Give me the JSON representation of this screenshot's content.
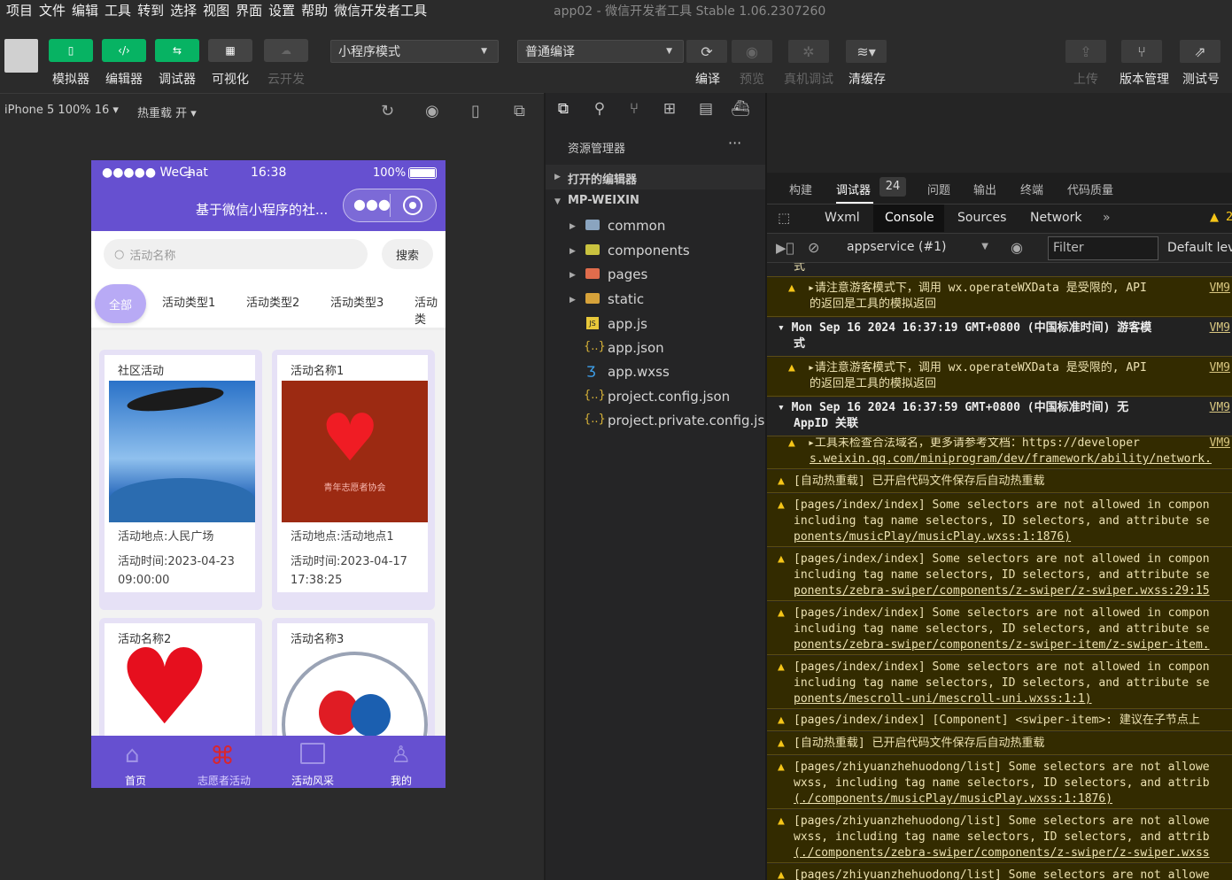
{
  "window": {
    "title": "app02 - 微信开发者工具 Stable 1.06.2307260"
  },
  "menu": [
    "项目",
    "文件",
    "编辑",
    "工具",
    "转到",
    "选择",
    "视图",
    "界面",
    "设置",
    "帮助",
    "微信开发者工具"
  ],
  "toolbar": {
    "left_buttons": [
      {
        "icon": "phone-icon",
        "label": "模拟器"
      },
      {
        "icon": "code-icon",
        "label": "编辑器"
      },
      {
        "icon": "debug-icon",
        "label": "调试器"
      },
      {
        "icon": "layout-icon",
        "label": "可视化"
      },
      {
        "icon": "cloud-icon",
        "label": "云开发"
      }
    ],
    "mode_select": "小程序模式",
    "compile_select": "普通编译",
    "mid_buttons": [
      {
        "icon": "refresh-icon",
        "label": "编译"
      },
      {
        "icon": "eye-icon",
        "label": "预览"
      },
      {
        "icon": "bug-icon",
        "label": "真机调试"
      },
      {
        "icon": "layers-icon",
        "label": "清缓存"
      }
    ],
    "right_buttons": [
      {
        "icon": "upload-icon",
        "label": "上传"
      },
      {
        "icon": "branch-icon",
        "label": "版本管理"
      },
      {
        "icon": "external-icon",
        "label": "测试号"
      }
    ]
  },
  "sim": {
    "device": "iPhone 5 100% 16",
    "hotreload": "热重载 开"
  },
  "phone": {
    "carrier": "●●●●● WeChat",
    "time": "16:38",
    "battery": "100%",
    "nav_title": "基于微信小程序的社...",
    "search_placeholder": "活动名称",
    "search_button": "搜索",
    "categories": [
      "全部",
      "活动类型1",
      "活动类型2",
      "活动类型3",
      "活动类"
    ],
    "cards": [
      {
        "title": "社区活动",
        "place": "活动地点:人民广场",
        "time1": "活动时间:2023-04-23",
        "time2": "09:00:00"
      },
      {
        "title": "活动名称1",
        "place": "活动地点:活动地点1",
        "time1": "活动时间:2023-04-17",
        "time2": "17:38:25"
      },
      {
        "title": "活动名称2"
      },
      {
        "title": "活动名称3"
      }
    ],
    "card1_logo_text": "青年志愿者协会",
    "tabbar": [
      "首页",
      "志愿者活动",
      "活动风采",
      "我的"
    ]
  },
  "explorer": {
    "title": "资源管理器",
    "open_editors": "打开的编辑器",
    "root": "MP-WEIXIN",
    "items": [
      {
        "name": "common",
        "type": "folder"
      },
      {
        "name": "components",
        "type": "folder"
      },
      {
        "name": "pages",
        "type": "folder"
      },
      {
        "name": "static",
        "type": "folder"
      },
      {
        "name": "app.js",
        "type": "js"
      },
      {
        "name": "app.json",
        "type": "json"
      },
      {
        "name": "app.wxss",
        "type": "css"
      },
      {
        "name": "project.config.json",
        "type": "json"
      },
      {
        "name": "project.private.config.js...",
        "type": "json"
      }
    ]
  },
  "debugger": {
    "tabs": [
      "构建",
      "调试器",
      "问题",
      "输出",
      "终端",
      "代码质量"
    ],
    "badge": "24",
    "devtools_tabs": [
      "Wxml",
      "Console",
      "Sources",
      "Network"
    ],
    "warn_count": "2",
    "context": "appservice (#1)",
    "filter_placeholder": "Filter",
    "levels": "Default leve",
    "logs": [
      {
        "g": "grp",
        "l1": "式"
      },
      {
        "w": "▸请注意游客模式下，调用 wx.operateWXData 是受限的, API",
        "l2": "的返回是工具的模拟返回",
        "vm": "VM9"
      },
      {
        "g": "grp",
        "l1": "▾ Mon Sep 16 2024 16:37:19 GMT+0800 (中国标准时间) 游客模",
        "l2": "式",
        "vm": "VM9"
      },
      {
        "w": "▸请注意游客模式下，调用 wx.operateWXData 是受限的, API",
        "l2": "的返回是工具的模拟返回",
        "vm": "VM9"
      },
      {
        "g": "grp",
        "l1": "▾ Mon Sep 16 2024 16:37:59 GMT+0800 (中国标准时间) 无",
        "l2": "AppID 关联",
        "vm": "VM9"
      },
      {
        "w": "▸工具未检查合法域名，更多请参考文档：https://developer",
        "l2": "s.weixin.qq.com/miniprogram/dev/framework/ability/network.",
        "vm": "VM9"
      },
      {
        "w": "[自动热重载] 已开启代码文件保存后自动热重载"
      },
      {
        "w": "[pages/index/index] Some selectors are not allowed in compon",
        "l2": "including tag name selectors, ID selectors, and attribute se",
        "l3": "ponents/musicPlay/musicPlay.wxss:1:1876)"
      },
      {
        "w": "[pages/index/index] Some selectors are not allowed in compon",
        "l2": "including tag name selectors, ID selectors, and attribute se",
        "l3": "ponents/zebra-swiper/components/z-swiper/z-swiper.wxss:29:15"
      },
      {
        "w": "[pages/index/index] Some selectors are not allowed in compon",
        "l2": "including tag name selectors, ID selectors, and attribute se",
        "l3": "ponents/zebra-swiper/components/z-swiper-item/z-swiper-item."
      },
      {
        "w": "[pages/index/index] Some selectors are not allowed in compon",
        "l2": "including tag name selectors, ID selectors, and attribute se",
        "l3": "ponents/mescroll-uni/mescroll-uni.wxss:1:1)"
      },
      {
        "w": "[pages/index/index] [Component] <swiper-item>: 建议在子节点上"
      },
      {
        "w": "[自动热重载] 已开启代码文件保存后自动热重载"
      },
      {
        "w": "[pages/zhiyuanzhehuodong/list] Some selectors are not allowe",
        "l2": "wxss, including tag name selectors, ID selectors, and attrib",
        "l3": "(./components/musicPlay/musicPlay.wxss:1:1876)"
      },
      {
        "w": "[pages/zhiyuanzhehuodong/list] Some selectors are not allowe",
        "l2": "wxss, including tag name selectors, ID selectors, and attrib",
        "l3": "(./components/zebra-swiper/components/z-swiper/z-swiper.wxss"
      },
      {
        "w": "[pages/zhiyuanzhehuodong/list] Some selectors are not allowe"
      }
    ]
  }
}
